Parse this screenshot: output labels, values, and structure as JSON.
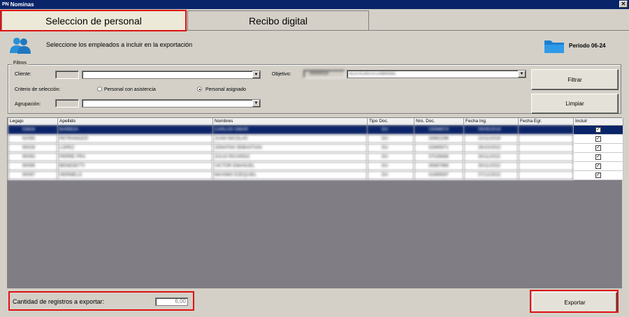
{
  "window": {
    "title": "Nominas",
    "logo": "PN",
    "close_label": "✕"
  },
  "tabs": [
    {
      "label": "Seleccion de personal",
      "active": true
    },
    {
      "label": "Recibo digital",
      "active": false
    }
  ],
  "header": {
    "instruction": "Seleccione los empleados a incluir en la exportación",
    "period": "Período 06-24"
  },
  "filters": {
    "legend": "Filtros",
    "cliente_label": "Cliente:",
    "objetivo_label": "Objetivo:",
    "objetivo_code": "00000019",
    "objetivo_value": "ACA PLANTA CAMPANA",
    "criterio_label": "Criterio de selección:",
    "radio_asistencia": "Personal con asistencia",
    "radio_asignado": "Personal asignado",
    "radio_selected": "asignado",
    "agrupacion_label": "Agrupación:",
    "filtrar_button": "Filtrar",
    "limpiar_button": "Limpiar"
  },
  "grid": {
    "columns": [
      "Legajo",
      "Apellido",
      "Nombres",
      "Tipo Doc.",
      "Nro. Doc.",
      "Fecha Ing.",
      "Fecha Egr.",
      "Incluir"
    ],
    "rows": [
      {
        "legajo": "53634",
        "apellido": "BARBOA",
        "nombres": "CARLOS OMAR",
        "tipo": "DU",
        "nro": "23068573",
        "ing": "05/05/2019",
        "egr": "",
        "incluir": true,
        "selected": true
      },
      {
        "legajo": "62095",
        "apellido": "PETRANOZZI",
        "nombres": "JUAN NICOLAS",
        "tipo": "DU",
        "nro": "28962296",
        "ing": "22/11/2019",
        "egr": "",
        "incluir": true,
        "selected": false
      },
      {
        "legajo": "90028",
        "apellido": "LOPEZ",
        "nombres": "JONATAN SEBASTIAN",
        "tipo": "DU",
        "nro": "32895971",
        "ing": "26/10/2022",
        "egr": "",
        "incluir": true,
        "selected": false
      },
      {
        "legajo": "90093",
        "apellido": "PERRE FRA",
        "nombres": "JULIO RICARDO",
        "tipo": "DU",
        "nro": "37026658",
        "ing": "30/11/2022",
        "egr": "",
        "incluir": true,
        "selected": false
      },
      {
        "legajo": "90096",
        "apellido": "BENEDETTI",
        "nombres": "VICTOR EMANUEL",
        "tipo": "DU",
        "nro": "35987969",
        "ing": "30/11/2022",
        "egr": "",
        "incluir": true,
        "selected": false
      },
      {
        "legajo": "90097",
        "apellido": "HERMELO",
        "nombres": "MAXIMO EZEQUIEL",
        "tipo": "DU",
        "nro": "41899597",
        "ing": "07/12/2022",
        "egr": "",
        "incluir": true,
        "selected": false
      }
    ]
  },
  "footer": {
    "count_label": "Cantidad de registros a exportar:",
    "count_value": "6,00",
    "export_button": "Exportar"
  },
  "icons": {
    "users": "users-icon",
    "folder": "folder-icon"
  },
  "colors": {
    "accent": "#0a246a",
    "highlight_box": "#e01010",
    "selection": "#0a246a"
  }
}
